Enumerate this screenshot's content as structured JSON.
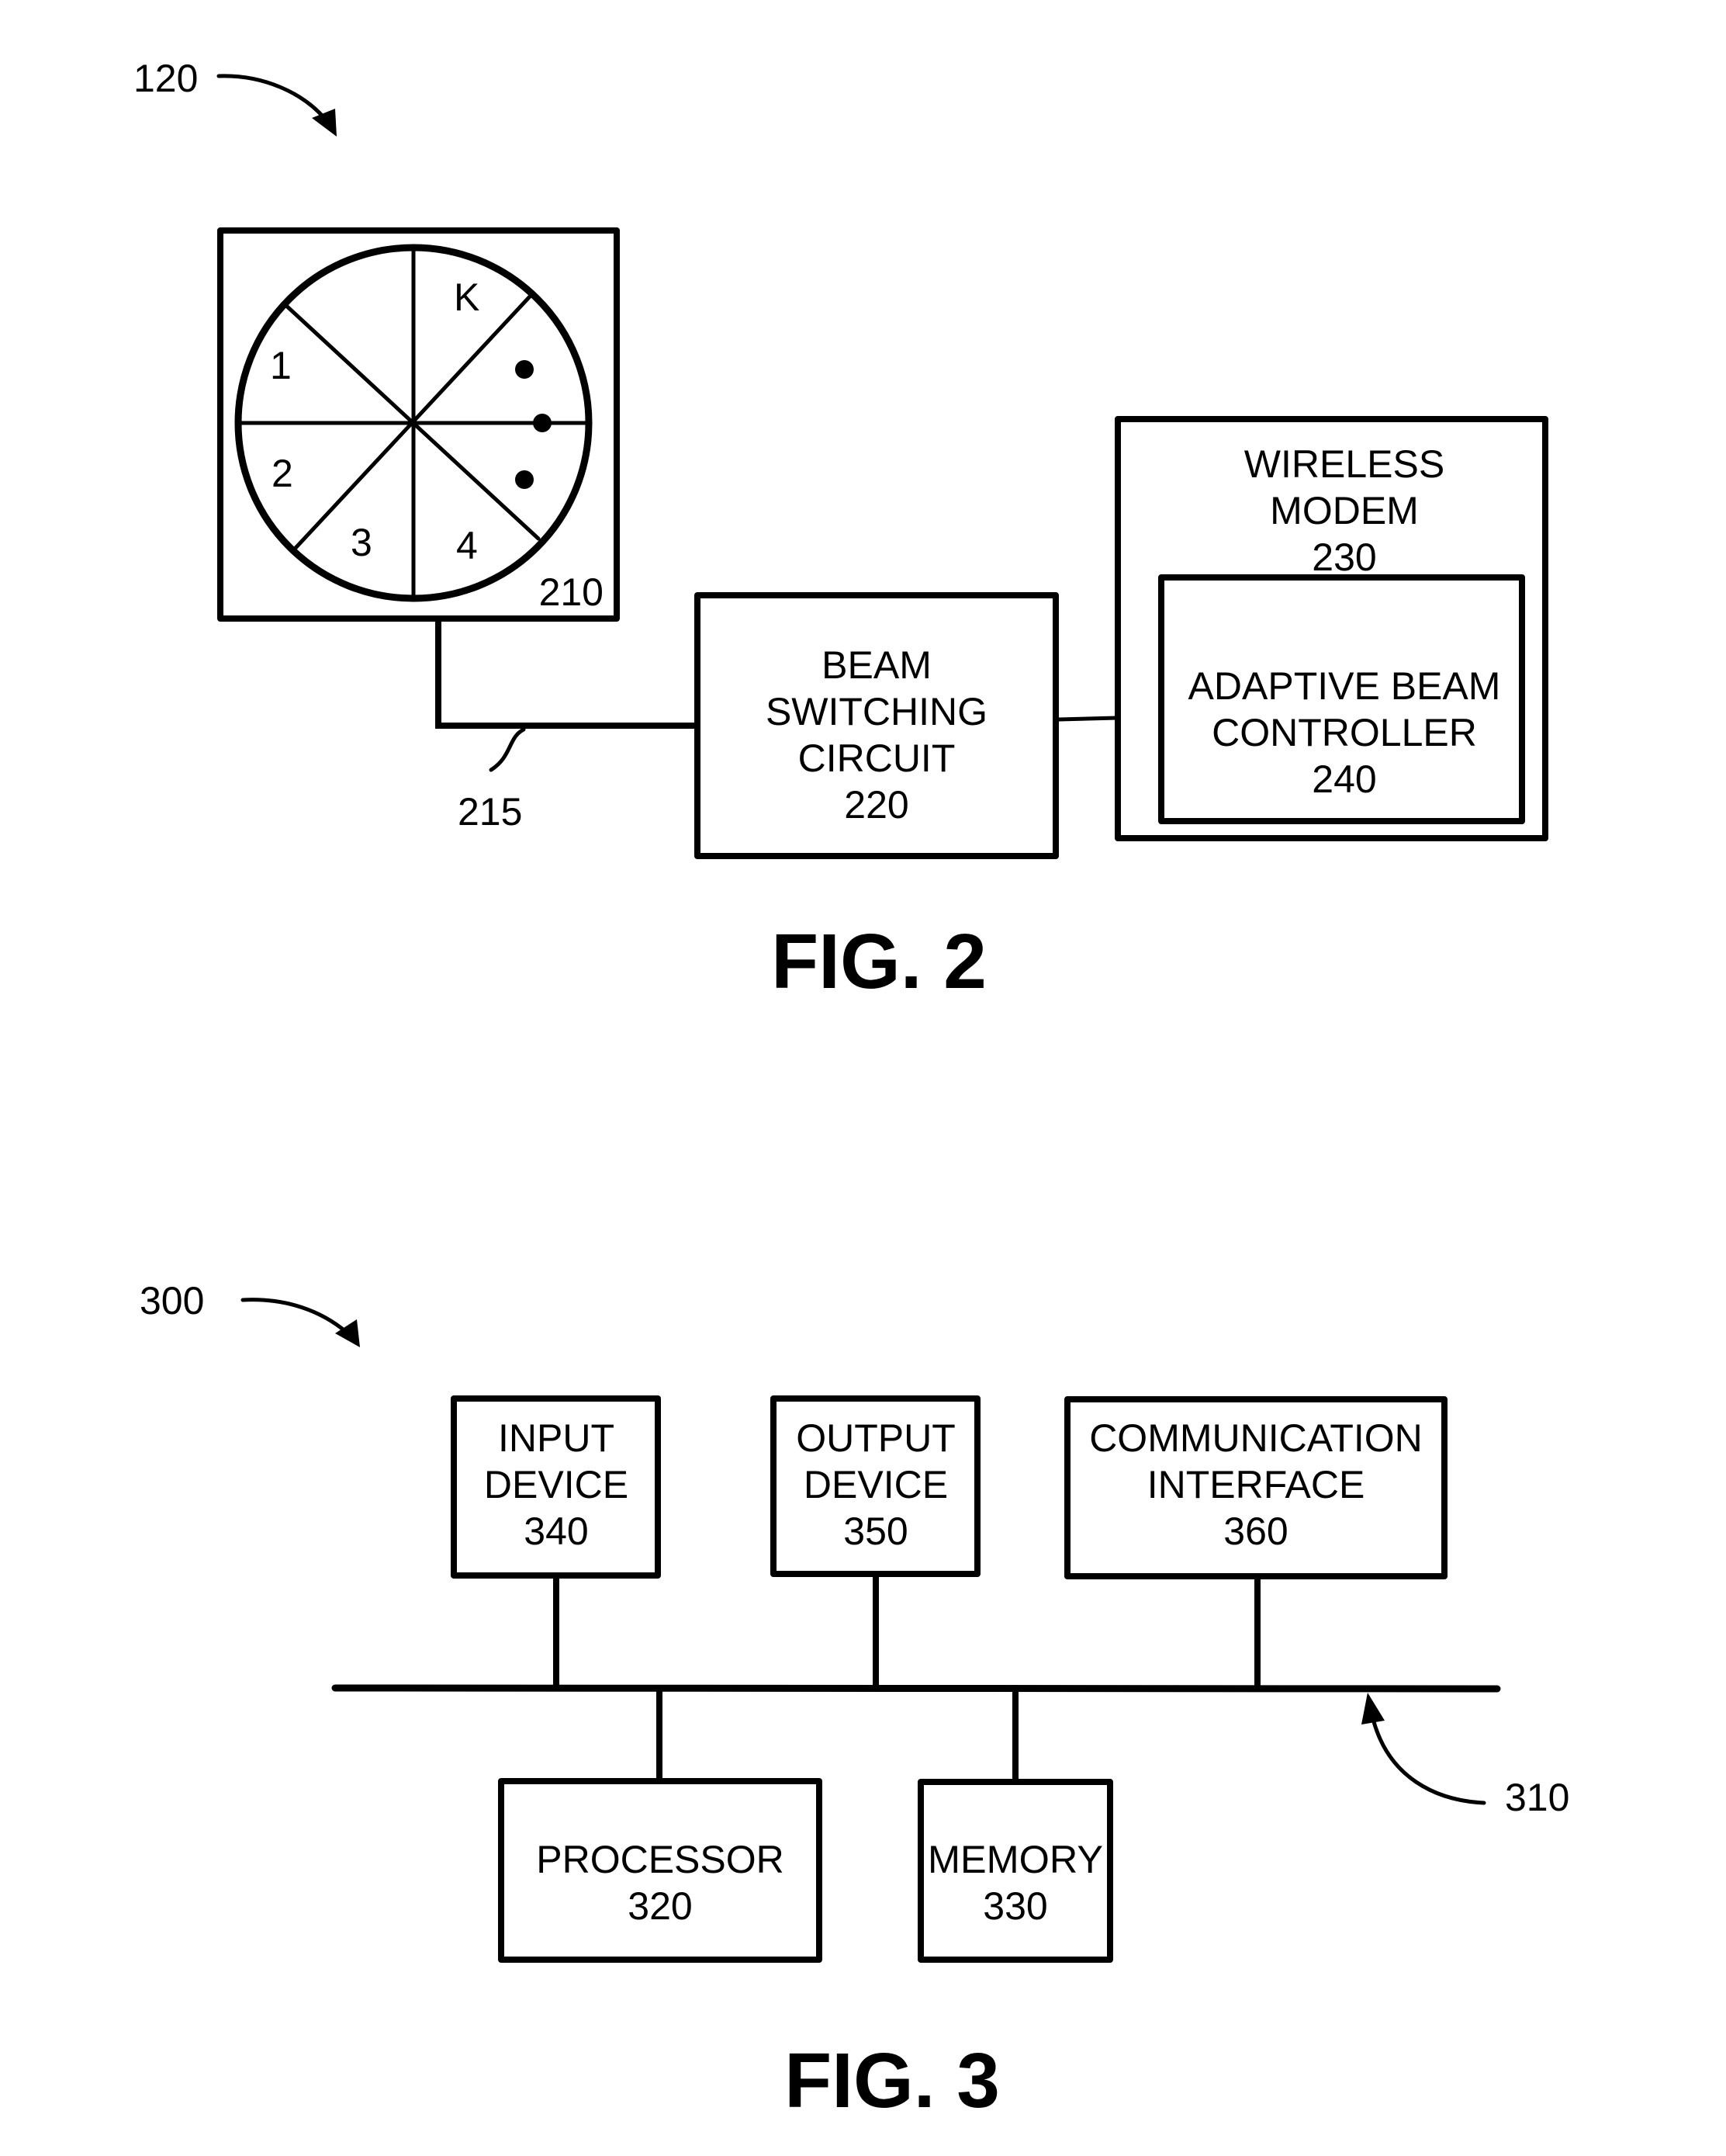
{
  "figures": [
    {
      "caption": "FIG. 2",
      "ref_label": "120",
      "antenna": {
        "ref": "210",
        "sector_labels": [
          "1",
          "2",
          "3",
          "4",
          "K"
        ],
        "ellipsis_dots": 3
      },
      "cable": {
        "ref": "215"
      },
      "blocks": {
        "beam_switching": {
          "lines": [
            "BEAM",
            "SWITCHING",
            "CIRCUIT"
          ],
          "ref": "220"
        },
        "wireless_modem": {
          "lines": [
            "WIRELESS",
            "MODEM"
          ],
          "ref": "230"
        },
        "adaptive_controller": {
          "lines": [
            "ADAPTIVE BEAM",
            "CONTROLLER"
          ],
          "ref": "240"
        }
      }
    },
    {
      "caption": "FIG. 3",
      "ref_label": "300",
      "bus": {
        "ref": "310"
      },
      "blocks": {
        "input_device": {
          "lines": [
            "INPUT",
            "DEVICE"
          ],
          "ref": "340"
        },
        "output_device": {
          "lines": [
            "OUTPUT",
            "DEVICE"
          ],
          "ref": "350"
        },
        "communication_interface": {
          "lines": [
            "COMMUNICATION",
            "INTERFACE"
          ],
          "ref": "360"
        },
        "processor": {
          "lines": [
            "PROCESSOR"
          ],
          "ref": "320"
        },
        "memory": {
          "lines": [
            "MEMORY"
          ],
          "ref": "330"
        }
      }
    }
  ],
  "colors": {
    "ink": "#000000",
    "paper": "#ffffff"
  }
}
